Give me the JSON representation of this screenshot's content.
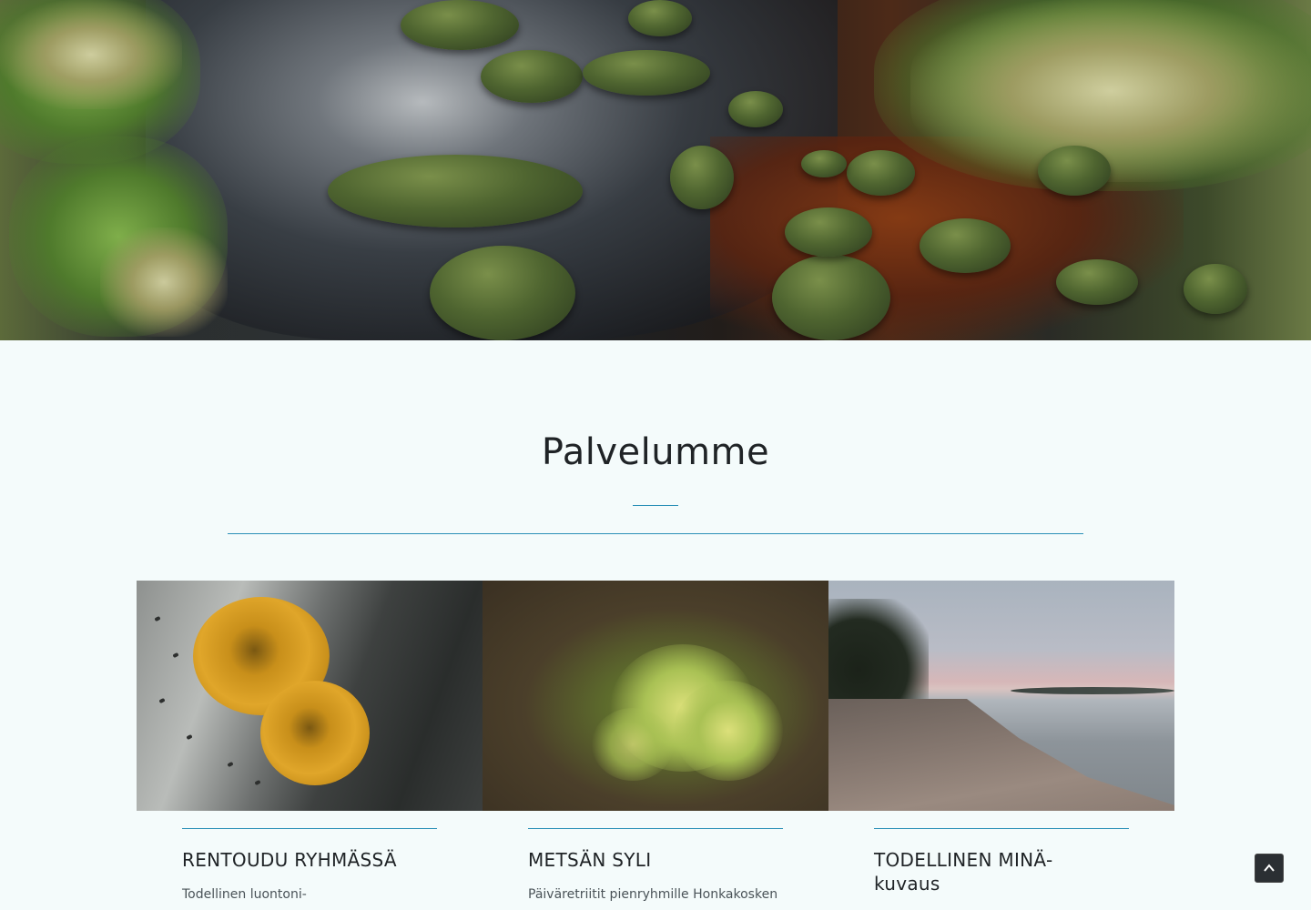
{
  "services": {
    "title": "Palvelumme",
    "cards": [
      {
        "title": "RENTOUDU RYHMÄSSÄ",
        "text": "Todellinen luontoni-"
      },
      {
        "title": "METSÄN SYLI",
        "text": "Päiväretriitit pienryhmille Honkakosken"
      },
      {
        "title": "TODELLINEN MINÄ-\nkuvaus",
        "title_line1": "TODELLINEN MINÄ-",
        "title_line2": "kuvaus",
        "text": ""
      }
    ]
  },
  "images": {
    "hero": "forest-stream-photo",
    "card1": "yellow-lichen-photo",
    "card2": "pine-sapling-photo",
    "card3": "seashore-sunset-photo"
  },
  "colors": {
    "background": "#f4fbfb",
    "accent": "#2a8fb7",
    "heading": "#1f2326"
  },
  "controls": {
    "scroll_top_icon": "chevron-up-icon"
  }
}
